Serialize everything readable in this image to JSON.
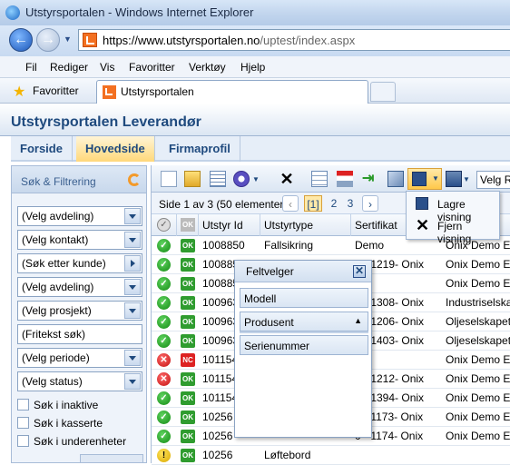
{
  "window": {
    "title": "Utstyrsportalen - Windows Internet Explorer"
  },
  "address": {
    "url_host": "https://www.utstyrsportalen.no",
    "url_path": "/uptest/index.aspx"
  },
  "menu": [
    "Fil",
    "Rediger",
    "Vis",
    "Favoritter",
    "Verktøy",
    "Hjelp"
  ],
  "favbar": {
    "favorites": "Favoritter",
    "tab_title": "Utstyrsportalen"
  },
  "app": {
    "title": "Utstyrsportalen Leverandør",
    "tabs": [
      "Forside",
      "Hovedside",
      "Firmaprofil"
    ],
    "active_tab": "Hovedside"
  },
  "sidebar": {
    "header": "Søk & Filtrering",
    "fields": [
      "(Velg avdeling)",
      "(Velg kontakt)",
      "(Søk etter kunde)",
      "(Velg avdeling)",
      "(Velg prosjekt)",
      "(Fritekst søk)",
      "(Velg periode)",
      "(Velg status)"
    ],
    "checks": [
      "Søk i inaktive",
      "Søk i kasserte",
      "Søk i underenheter"
    ]
  },
  "toolbar": {
    "view_select": "Velg Ra"
  },
  "pager": {
    "text": "Side 1 av 3 (50 elementer)",
    "pages": [
      "[1]",
      "2",
      "3"
    ]
  },
  "grid": {
    "columns": [
      "OK",
      "Utstyr Id",
      "Utstyrtype",
      "Sertifikat",
      ""
    ],
    "rows": [
      {
        "st": "ok",
        "badge": "OK",
        "id": "1008850",
        "type": "Fallsikring",
        "cert": "Demo",
        "owner": "Onix Demo Expr"
      },
      {
        "st": "ok",
        "badge": "OK",
        "id": "100885",
        "type": "",
        "cert": "0 - 1219- Onix",
        "owner": "Onix Demo Expr"
      },
      {
        "st": "ok",
        "badge": "OK",
        "id": "100885",
        "type": "",
        "cert": "o",
        "owner": "Onix Demo Expr"
      },
      {
        "st": "ok",
        "badge": "OK",
        "id": "100963",
        "type": "",
        "cert": "0 - 1308- Onix",
        "owner": "Industriselskape"
      },
      {
        "st": "ok",
        "badge": "OK",
        "id": "100963",
        "type": "",
        "cert": "0 - 1206- Onix",
        "owner": "Oljeselskapet A"
      },
      {
        "st": "ok",
        "badge": "OK",
        "id": "100963",
        "type": "",
        "cert": "0 - 1403- Onix",
        "owner": "Oljeselskapet A"
      },
      {
        "st": "err",
        "badge": "NC",
        "id": "101154",
        "type": "",
        "cert": "o",
        "owner": "Onix Demo Expr"
      },
      {
        "st": "err",
        "badge": "OK",
        "id": "101154",
        "type": "",
        "cert": "0 - 1212- Onix",
        "owner": "Onix Demo Expr"
      },
      {
        "st": "ok",
        "badge": "OK",
        "id": "101154",
        "type": "",
        "cert": "0 - 1394- Onix",
        "owner": "Onix Demo Expr"
      },
      {
        "st": "ok",
        "badge": "OK",
        "id": "10256",
        "type": "",
        "cert": "0 - 1173- Onix",
        "owner": "Onix Demo Expr"
      },
      {
        "st": "ok",
        "badge": "OK",
        "id": "10256",
        "type": "",
        "cert": "0 - 1174- Onix",
        "owner": "Onix Demo Expr"
      },
      {
        "st": "warn",
        "badge": "OK",
        "id": "10256",
        "type": "Løftebord",
        "cert": "",
        "owner": ""
      }
    ]
  },
  "context_menu": {
    "items": [
      "Lagre visning",
      "Fjern visning"
    ]
  },
  "field_picker": {
    "title": "Feltvelger",
    "items": [
      "Modell",
      "Produsent",
      "Serienummer"
    ]
  }
}
